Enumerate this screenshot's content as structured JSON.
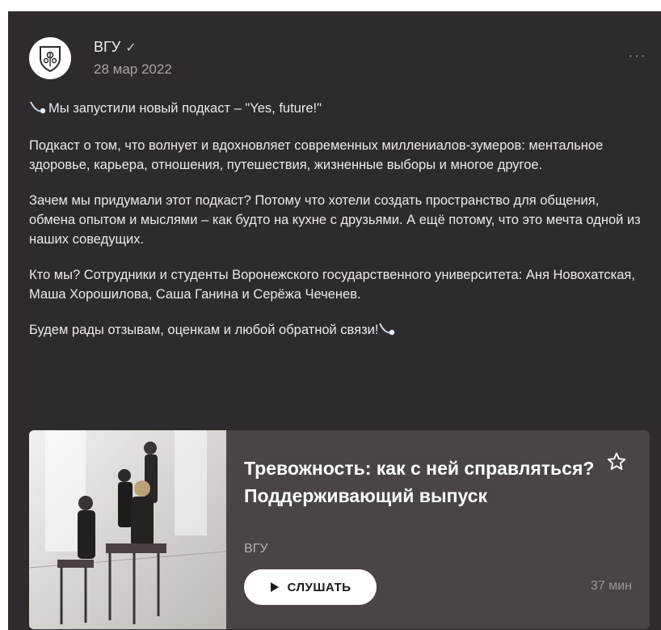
{
  "post": {
    "author": "ВГУ",
    "verified_mark": "✓",
    "date": "28 мар 2022",
    "more_icon": "···",
    "paragraphs": [
      "Мы запустили новый подкаст – \"Yes, future!\"",
      "Подкаст о том, что волнует и вдохновляет современных миллениалов-зумеров: ментальное здоровье, карьера, отношения, путешествия, жизненные выборы и многое другое.",
      "Зачем мы придумали этот подкаст? Потому что хотели создать пространство для общения, обмена опытом и мыслями – как будто на кухне с друзьями. А ещё потому, что это мечта одной из наших соведущих.",
      "Кто мы? Сотрудники и студенты Воронежского государственного университета: Аня Новохатская, Маша Хорошилова, Саша Ганина и Серёжа Чеченев.",
      "Будем рады отзывам, оценкам и любой обратной связи!"
    ]
  },
  "podcast": {
    "title": "Тревожность: как с ней справляться? Поддерживающий выпуск",
    "author": "ВГУ",
    "listen_label": "СЛУШАТЬ",
    "duration": "37 мин"
  },
  "colors": {
    "card_bg": "#2f2a2e",
    "podcast_bg": "#4a4348",
    "text": "#ece8ea",
    "muted": "#a9a2a6"
  }
}
